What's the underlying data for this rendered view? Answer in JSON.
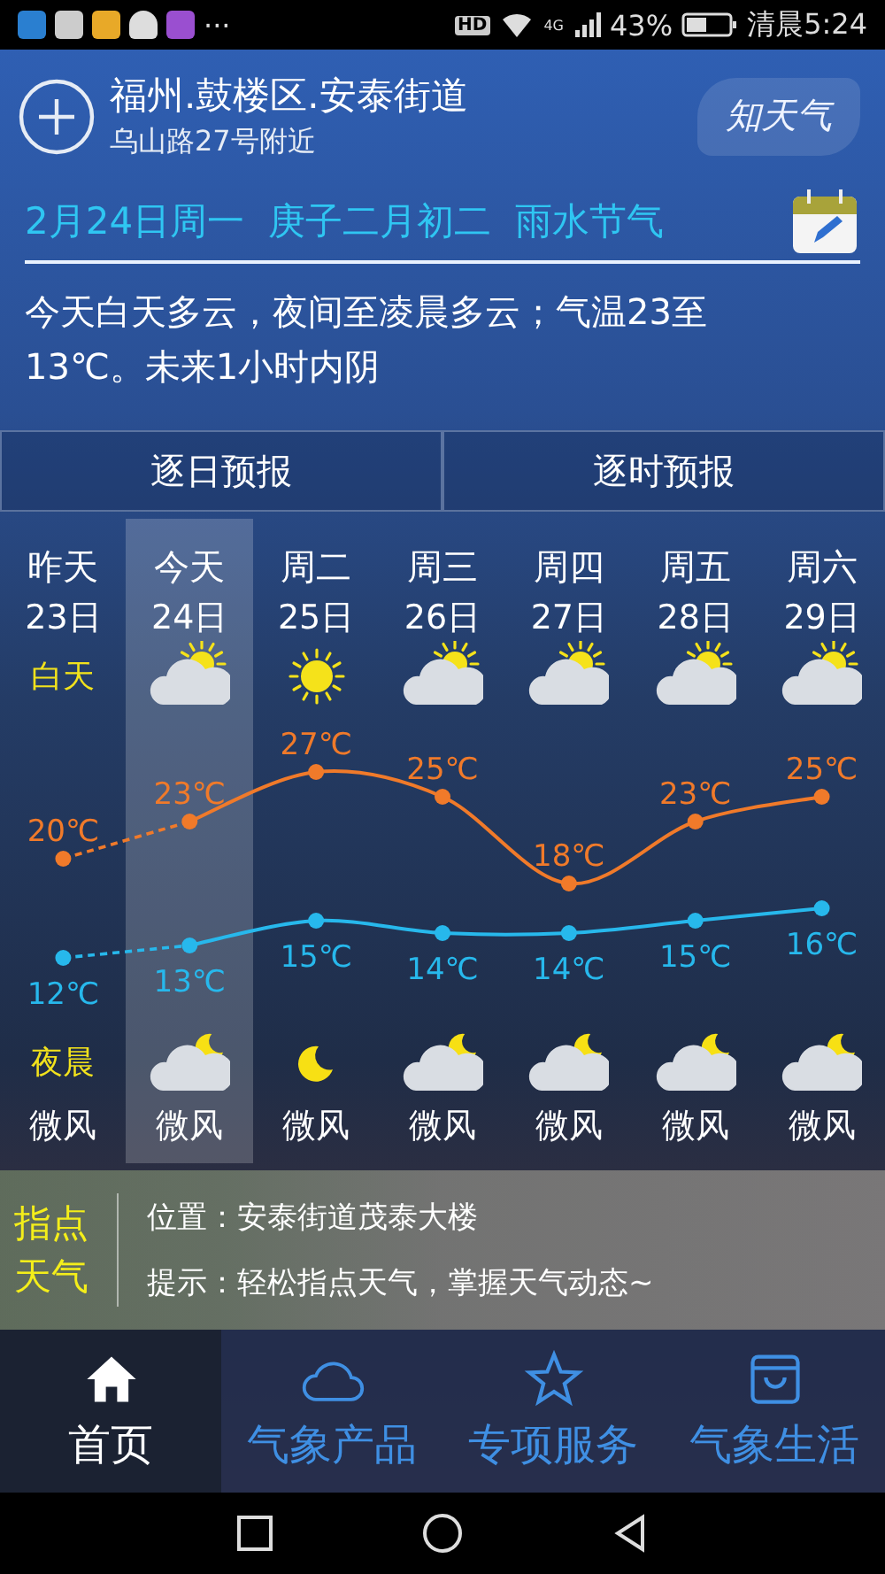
{
  "status_bar": {
    "more": "···",
    "hd": "HD",
    "network": "4G",
    "battery": "43%",
    "time": "清晨5:24"
  },
  "header": {
    "location": "福州.鼓楼区.安泰街道",
    "sublocation": "乌山路27号附近",
    "logo": "知天气"
  },
  "date_line": "2月24日周一  庚子二月初二  雨水节气",
  "summary": "今天白天多云，夜间至凌晨多云；气温23至13℃。未来1小时内阴",
  "tabs": [
    {
      "label": "逐日预报"
    },
    {
      "label": "逐时预报"
    }
  ],
  "days": [
    {
      "name": "昨天",
      "date": "23日",
      "day": {
        "kind": "label",
        "label": "白天"
      },
      "high": "20℃",
      "low": "12℃",
      "night": {
        "kind": "label",
        "label": "夜晨"
      },
      "wind": "微风",
      "selected": false
    },
    {
      "name": "今天",
      "date": "24日",
      "day": {
        "kind": "partly_cloudy"
      },
      "high": "23℃",
      "low": "13℃",
      "night": {
        "kind": "cloudy_night"
      },
      "wind": "微风",
      "selected": true
    },
    {
      "name": "周二",
      "date": "25日",
      "day": {
        "kind": "sunny"
      },
      "high": "27℃",
      "low": "15℃",
      "night": {
        "kind": "clear_night"
      },
      "wind": "微风",
      "selected": false
    },
    {
      "name": "周三",
      "date": "26日",
      "day": {
        "kind": "partly_cloudy"
      },
      "high": "25℃",
      "low": "14℃",
      "night": {
        "kind": "cloudy_night"
      },
      "wind": "微风",
      "selected": false
    },
    {
      "name": "周四",
      "date": "27日",
      "day": {
        "kind": "partly_cloudy"
      },
      "high": "18℃",
      "low": "14℃",
      "night": {
        "kind": "cloudy_night"
      },
      "wind": "微风",
      "selected": false
    },
    {
      "name": "周五",
      "date": "28日",
      "day": {
        "kind": "partly_cloudy"
      },
      "high": "23℃",
      "low": "15℃",
      "night": {
        "kind": "cloudy_night"
      },
      "wind": "微风",
      "selected": false
    },
    {
      "name": "周六",
      "date": "29日",
      "day": {
        "kind": "partly_cloudy"
      },
      "high": "25℃",
      "low": "16℃",
      "night": {
        "kind": "cloudy_night"
      },
      "wind": "微风",
      "selected": false
    }
  ],
  "tip_panel": {
    "title": "指点天气",
    "location": "位置：安泰街道茂泰大楼",
    "hint": "提示：轻松指点天气，掌握天气动态~"
  },
  "bottom_nav": [
    {
      "label": "首页",
      "kind": "home",
      "selected": true
    },
    {
      "label": "气象产品",
      "kind": "cloud",
      "selected": false
    },
    {
      "label": "专项服务",
      "kind": "star",
      "selected": false
    },
    {
      "label": "气象生活",
      "kind": "bag",
      "selected": false
    }
  ]
}
